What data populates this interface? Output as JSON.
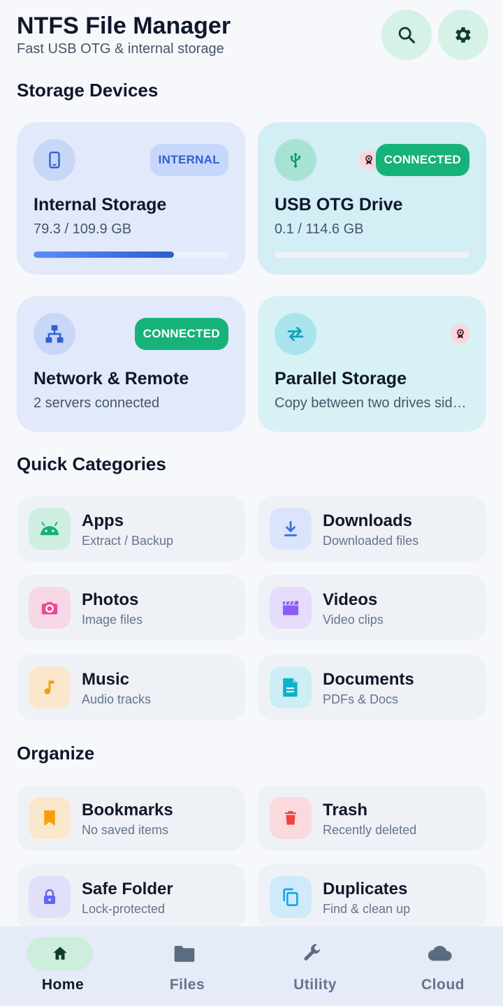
{
  "header": {
    "title": "NTFS File Manager",
    "subtitle": "Fast USB OTG & internal storage",
    "search_icon": "search-icon",
    "settings_icon": "gear-icon"
  },
  "sections": {
    "storage": "Storage Devices",
    "categories": "Quick Categories",
    "organize": "Organize"
  },
  "devices": [
    {
      "name": "Internal Storage",
      "sub": "79.3 / 109.9 GB",
      "badge": "INTERNAL",
      "icon": "smartphone-icon",
      "usage_fraction": 0.72
    },
    {
      "name": "USB OTG Drive",
      "sub": "0.1 / 114.6 GB",
      "badge": "CONNECTED",
      "icon": "usb-icon",
      "extra_icon": "award-ribbon-icon",
      "usage_fraction": 0.001
    },
    {
      "name": "Network & Remote",
      "sub": "2 servers connected",
      "badge": "CONNECTED",
      "icon": "network-icon"
    },
    {
      "name": "Parallel Storage",
      "sub": "Copy between two drives side by side",
      "icon": "swap-arrows-icon",
      "extra_icon": "award-ribbon-icon"
    }
  ],
  "categories": [
    {
      "title": "Apps",
      "sub": "Extract / Backup",
      "icon": "android-icon"
    },
    {
      "title": "Downloads",
      "sub": "Downloaded files",
      "icon": "download-icon"
    },
    {
      "title": "Photos",
      "sub": "Image files",
      "icon": "camera-icon"
    },
    {
      "title": "Videos",
      "sub": "Video clips",
      "icon": "clapperboard-icon"
    },
    {
      "title": "Music",
      "sub": "Audio tracks",
      "icon": "music-note-icon"
    },
    {
      "title": "Documents",
      "sub": "PDFs & Docs",
      "icon": "document-icon"
    }
  ],
  "organize": [
    {
      "title": "Bookmarks",
      "sub": "No saved items",
      "icon": "bookmark-icon"
    },
    {
      "title": "Trash",
      "sub": "Recently deleted",
      "icon": "trash-icon"
    },
    {
      "title": "Safe Folder",
      "sub": "Lock-protected",
      "icon": "lock-icon"
    },
    {
      "title": "Duplicates",
      "sub": "Find & clean up",
      "icon": "copy-icon"
    }
  ],
  "nav": [
    {
      "label": "Home",
      "icon": "home-icon",
      "active": true
    },
    {
      "label": "Files",
      "icon": "folder-icon"
    },
    {
      "label": "Utility",
      "icon": "wrench-icon"
    },
    {
      "label": "Cloud",
      "icon": "cloud-icon"
    }
  ],
  "colors": {
    "accent_green": "#16b27a",
    "internal_card": "#e1e9fb",
    "usb_card": "#d3eef4",
    "network_card": "#e1e9fb",
    "parallel_card": "#d8f1f4",
    "bar_fill": "#2a5ed6"
  }
}
